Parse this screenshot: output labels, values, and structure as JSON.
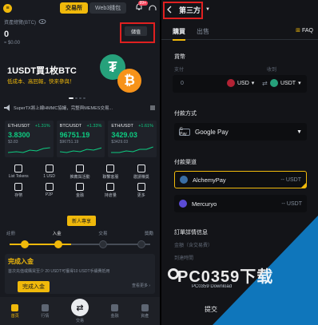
{
  "left": {
    "header": {
      "tabs": [
        {
          "label": "交易所"
        },
        {
          "label": "Web3錢包"
        }
      ],
      "notif_count": "99+"
    },
    "balance": {
      "label": "資產總覽(BTC)",
      "value": "0",
      "sub": "≈ $0.00",
      "deposit_label": "儲值"
    },
    "promo": {
      "title": "1USDT買1枚BTC",
      "subtitle": "低成本、高回報，快來參與！",
      "coin1": "₮",
      "coin2": "₿"
    },
    "ticker": {
      "text": "SuperTX將上線HMMC協議，完整與MEMES交易..."
    },
    "markets": [
      {
        "pair": "ETH/USDT",
        "change": "+1.31%",
        "price": "3.8300",
        "usd": "$3.83"
      },
      {
        "pair": "BTC/USDT",
        "change": "+1.33%",
        "price": "96751.19",
        "usd": "$96751.19"
      },
      {
        "pair": "ETH/USDT",
        "change": "+1.61%",
        "price": "3429.03",
        "usd": "$3429.03"
      }
    ],
    "grid": [
      {
        "label": "List Tokens"
      },
      {
        "label": "1 USD"
      },
      {
        "label": "推薦與活動"
      },
      {
        "label": "聯繫客服"
      },
      {
        "label": "邀請賺獎"
      },
      {
        "label": "存幣"
      },
      {
        "label": "P2P"
      },
      {
        "label": "金融"
      },
      {
        "label": "持倉量"
      },
      {
        "label": "更多"
      }
    ],
    "new_user": "新人專享",
    "steps": [
      {
        "label": "註冊"
      },
      {
        "label": "入金"
      },
      {
        "label": "交易"
      },
      {
        "label": "獎勵"
      }
    ],
    "deposit_card": {
      "title": "完成入金",
      "desc": "首次充值或購買至少 20 USDT可獲得10 USDT手續費抵用",
      "btn": "完成入金",
      "more": "查看更多 ›"
    },
    "bottom_nav": [
      {
        "label": "首頁"
      },
      {
        "label": "行情"
      },
      {
        "label": "交易"
      },
      {
        "label": "金融"
      },
      {
        "label": "資產"
      }
    ],
    "accent": "#f0b90b"
  },
  "right": {
    "title": "第三方",
    "tabs": [
      {
        "label": "購買"
      },
      {
        "label": "出售"
      }
    ],
    "faq": "FAQ",
    "currency_label": "貨幣",
    "pay_label": "支付",
    "receive_label": "收到",
    "amount": "0",
    "fiat": "USD",
    "crypto": "USDT",
    "method_label": "付款方式",
    "method_badge": "G Pay",
    "method_value": "Google Pay",
    "channel_label": "付款渠道",
    "channels": [
      {
        "name": "AlchemyPay",
        "value": "-- USDT"
      },
      {
        "name": "Mercuryo",
        "value": "-- USDT"
      }
    ],
    "order_title": "訂單詳情信息",
    "order_rows": [
      {
        "label": "金額（含交易費）"
      },
      {
        "label": "到達時間"
      }
    ],
    "submit": "提交"
  },
  "watermark": {
    "title": "PC0359下载",
    "sub": "PC0359 Download"
  }
}
